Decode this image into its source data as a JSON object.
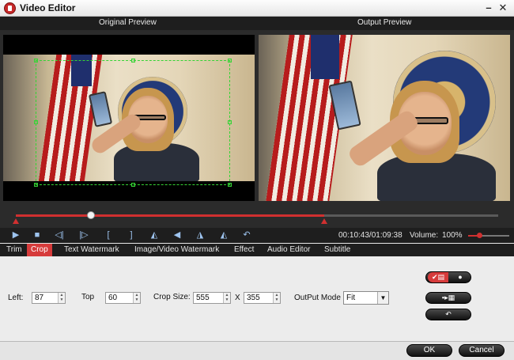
{
  "window": {
    "title": "Video Editor",
    "minimize_glyph": "–",
    "close_glyph": "✕"
  },
  "preview": {
    "original_label": "Original Preview",
    "output_label": "Output Preview"
  },
  "playback": {
    "progress": 0.155,
    "time_display": "00:10:43/01:09:38",
    "volume_label": "Volume:",
    "volume_value": "100%",
    "buttons": [
      "play-icon",
      "stop-icon",
      "prev-frame-icon",
      "next-frame-icon",
      "mark-in-icon",
      "mark-out-icon",
      "flip-horizontal-icon",
      "flip-vertical-icon",
      "rotate-left-icon",
      "rotate-right-icon",
      "undo-icon"
    ]
  },
  "tabs": [
    "Trim",
    "Crop",
    "Text Watermark",
    "Image/Video Watermark",
    "Effect",
    "Audio Editor",
    "Subtitle"
  ],
  "active_tab": "Crop",
  "crop": {
    "left_label": "Left:",
    "left_value": "87",
    "top_label": "Top",
    "top_value": "60",
    "size_label": "Crop Size:",
    "width_value": "555",
    "separator": "X",
    "height_value": "355",
    "output_mode_label": "OutPut Mode",
    "output_mode_value": "Fit"
  },
  "buttons": {
    "ok": "OK",
    "cancel": "Cancel"
  },
  "colors": {
    "accent": "#d63b3b",
    "crop_border": "#35d435",
    "dark_bar": "#1e1e1e"
  }
}
